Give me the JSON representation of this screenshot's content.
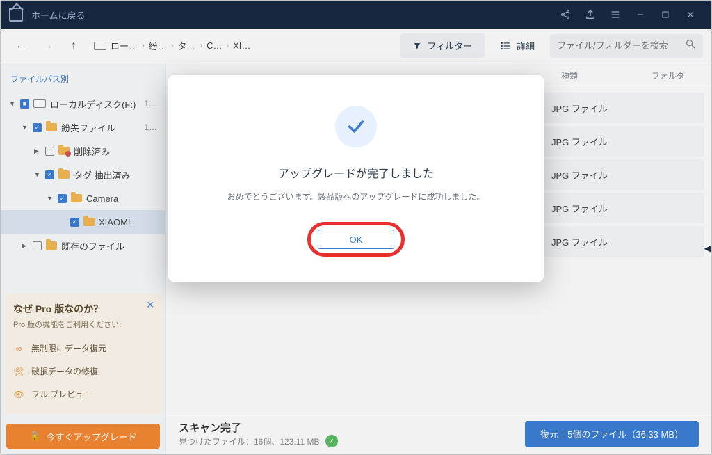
{
  "titlebar": {
    "home": "ホームに戻る"
  },
  "toolbar": {
    "breadcrumb": [
      "ロー…",
      "紛…",
      "タ…",
      "C…",
      "XI…"
    ],
    "filter": "フィルター",
    "detail": "詳細",
    "search_placeholder": "ファイル/フォルダーを検索"
  },
  "sidebar": {
    "title": "ファイルパス別",
    "tree": [
      {
        "label": "ローカルディスク(F:)",
        "depth": 0,
        "kind": "drive",
        "check": "partial",
        "expanded": true,
        "count": "1…"
      },
      {
        "label": "紛失ファイル",
        "depth": 1,
        "kind": "folder-orange",
        "check": "checked",
        "expanded": true,
        "count": "1…"
      },
      {
        "label": "削除済み",
        "depth": 2,
        "kind": "folder-trash",
        "check": "empty",
        "expanded": false
      },
      {
        "label": "タグ 抽出済み",
        "depth": 2,
        "kind": "folder-orange",
        "check": "checked",
        "expanded": true
      },
      {
        "label": "Camera",
        "depth": 3,
        "kind": "folder-yellow",
        "check": "checked",
        "expanded": true
      },
      {
        "label": "XIAOMI",
        "depth": 4,
        "kind": "folder-yellow",
        "check": "checked",
        "selected": true
      },
      {
        "label": "既存のファイル",
        "depth": 1,
        "kind": "folder-yellow",
        "check": "empty",
        "expanded": false
      }
    ]
  },
  "pro": {
    "title": "なぜ Pro 版なのか？",
    "sub": "Pro 版の機能をご利用ください:",
    "items": [
      "無制限にデータ復元",
      "破損データの修復",
      "フル プレビュー"
    ],
    "upgrade": "今すぐアップグレード"
  },
  "columns": {
    "c1": "",
    "c2": "種類",
    "c3": "フォルダ"
  },
  "files": [
    {
      "type": "JPG ファイル"
    },
    {
      "type": "JPG ファイル"
    },
    {
      "type": "JPG ファイル"
    },
    {
      "type": "JPG ファイル"
    },
    {
      "type": "JPG ファイル"
    }
  ],
  "footer": {
    "title": "スキャン完了",
    "sub": "見つけたファイル：16個、123.11 MB",
    "recover": "復元｜5個のファイル（36.33 MB）"
  },
  "dialog": {
    "title": "アップグレードが完了しました",
    "body": "おめでとうございます。製品版へのアップグレードに成功しました。",
    "ok": "OK"
  }
}
